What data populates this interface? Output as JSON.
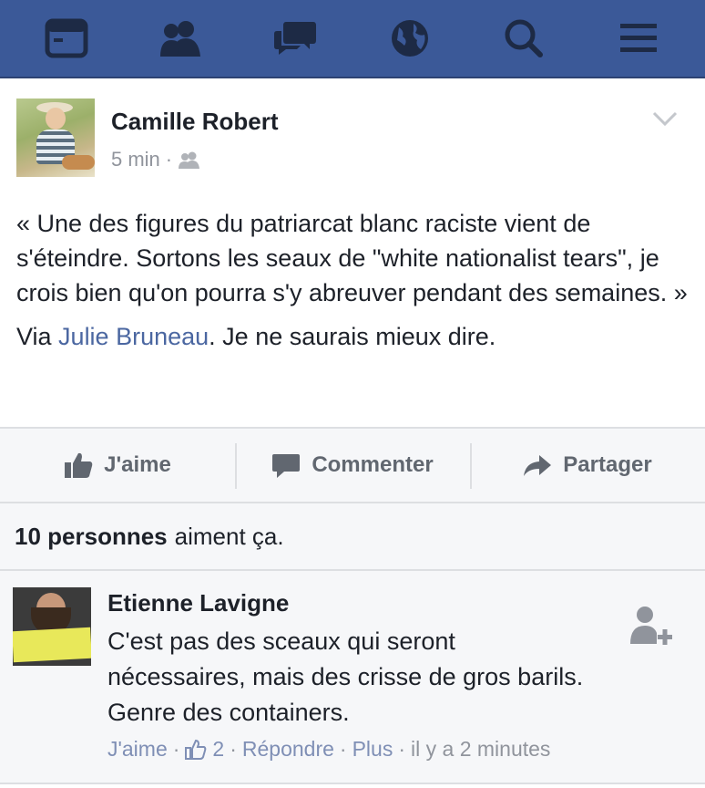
{
  "nav": {
    "items": [
      {
        "name": "news-feed",
        "icon": "newsfeed-icon"
      },
      {
        "name": "friends",
        "icon": "friends-icon"
      },
      {
        "name": "messages",
        "icon": "messages-icon"
      },
      {
        "name": "notifications",
        "icon": "globe-icon"
      },
      {
        "name": "search",
        "icon": "search-icon"
      },
      {
        "name": "menu",
        "icon": "menu-icon"
      }
    ],
    "color": "#3b5998"
  },
  "post": {
    "author": "Camille Robert",
    "time": "5 min",
    "separator": "·",
    "audience_icon": "friends-icon",
    "paragraph1": "« Une des figures du patriarcat blanc raciste vient de s'éteindre. Sortons les seaux de \"white nationalist tears\", je crois bien qu'on pourra s'y abreuver pendant des semaines. »",
    "via_prefix": "Via ",
    "via_link": "Julie Bruneau",
    "via_suffix": ". Je ne saurais mieux dire."
  },
  "actions": {
    "like_label": "J'aime",
    "comment_label": "Commenter",
    "share_label": "Partager"
  },
  "likes": {
    "count_label": "10 personnes",
    "suffix": "aiment ça."
  },
  "comment": {
    "author": "Etienne Lavigne",
    "text": "C'est pas des sceaux qui seront nécessaires, mais des crisse de gros barils. Genre des containers.",
    "like_label": "J'aime",
    "sep": "·",
    "like_count": "2",
    "reply_label": "Répondre",
    "more_label": "Plus",
    "time": "il y a 2 minutes"
  },
  "colors": {
    "link": "#4b67a1",
    "muted": "#90949c",
    "bar_bg": "#f6f7f9"
  }
}
